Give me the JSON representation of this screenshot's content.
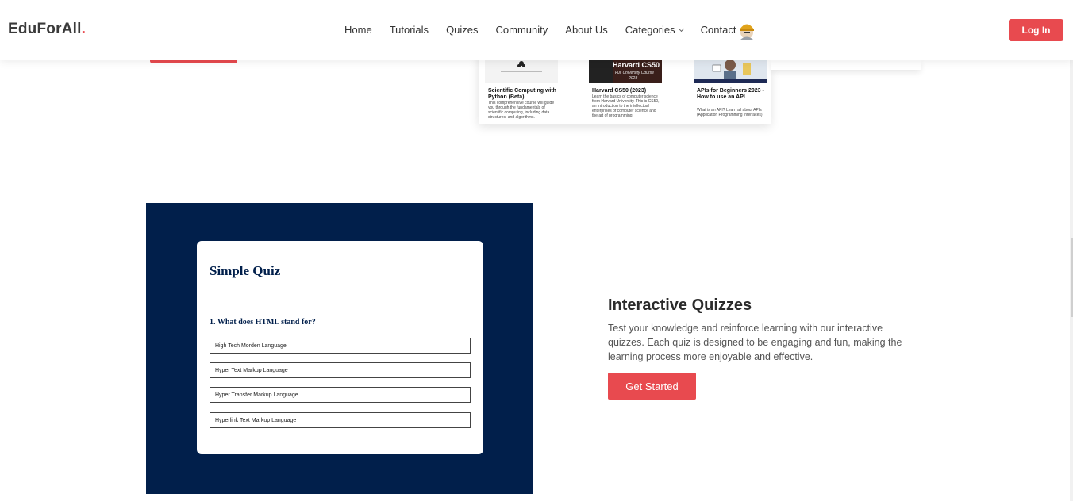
{
  "header": {
    "logo_text": "EduForAll",
    "logo_dot": ".",
    "nav": [
      {
        "label": "Home"
      },
      {
        "label": "Tutorials"
      },
      {
        "label": "Quizes"
      },
      {
        "label": "Community"
      },
      {
        "label": "About Us"
      },
      {
        "label": "Categories"
      },
      {
        "label": "Contact"
      }
    ],
    "login_label": "Log In"
  },
  "courses": [
    {
      "title": "Scientific Computing with Python (Beta)",
      "desc": "This comprehensive course will guide you through the fundamentals of scientific computing, including data structures, and algorithms."
    },
    {
      "title": "Harvard CS50 (2023)",
      "thumb_title": "Harvard CS50",
      "thumb_sub": "Full University Course",
      "thumb_year": "2023",
      "desc": "Learn the basics of computer science from Harvard University. This is CS50, an introduction to the intellectual enterprises of computer science and the art of programming."
    },
    {
      "title": "APIs for Beginners 2023 - How to use an API",
      "desc": "What is an API? Learn all about APIs (Application Programming Interfaces)"
    }
  ],
  "quiz": {
    "title": "Simple Quiz",
    "question": "1. What does HTML stand for?",
    "options": [
      "High Tech Morden Language",
      "Hyper Text Markup Language",
      "Hyper Transfer Markup Language",
      "Hyperlink Text Markup Language"
    ]
  },
  "feature": {
    "title": "Interactive Quizzes",
    "description": "Test your knowledge and reinforce learning with our interactive quizzes. Each quiz is designed to be engaging and fun, making the learning process more enjoyable and effective.",
    "cta_label": "Get Started"
  },
  "colors": {
    "accent": "#e84a4f",
    "navy": "#011f4b"
  }
}
